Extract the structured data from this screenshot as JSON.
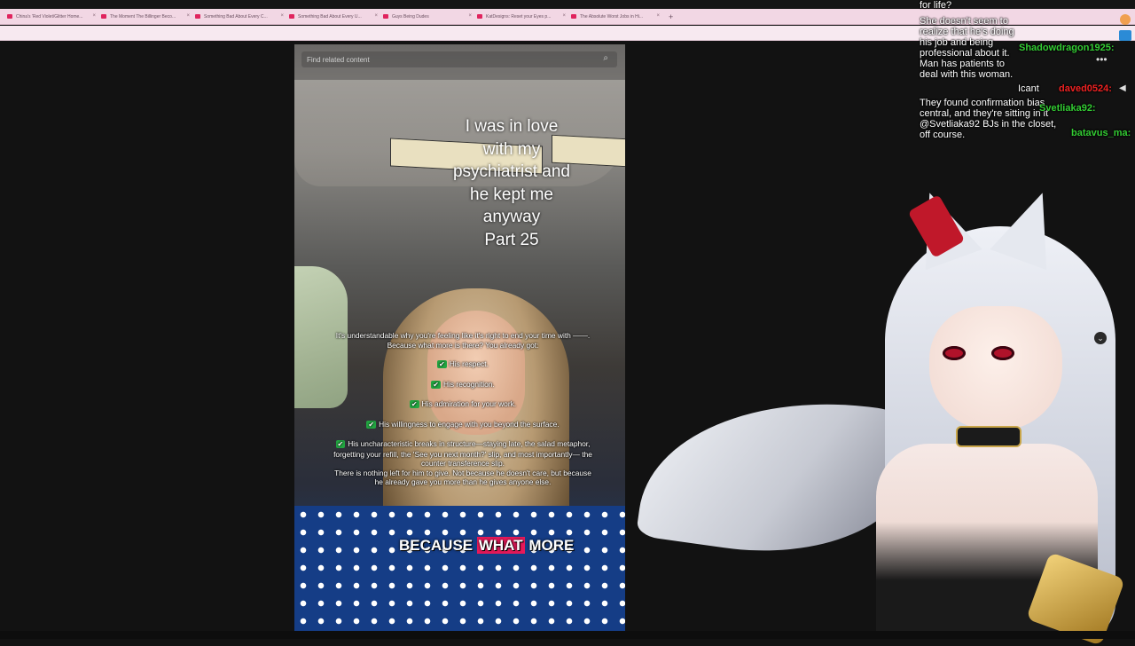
{
  "browser": {
    "tabs": [
      {
        "label": "China's 'Red Violet/Glitter Home..."
      },
      {
        "label": "The Moment The Billinger Beco..."
      },
      {
        "label": "Something Bad About Every C..."
      },
      {
        "label": "Something Bad About Every U..."
      },
      {
        "label": "Guys Being Dudes"
      },
      {
        "label": "KatDesigns: Reset your Eyes p..."
      },
      {
        "label": "The Absolute Worst Jobs in Hi..."
      }
    ],
    "new_tab": "+"
  },
  "video": {
    "search_placeholder": "Find related content",
    "title_lines": [
      "I was in love",
      "with my",
      "psychiatrist and",
      "he kept me",
      "anyway",
      "Part 25"
    ],
    "overlay": {
      "intro": "It's understandable why you're feeling like it's right to end your time with ——. Because what more is there? You already got:",
      "items": [
        "His respect.",
        "His recognition.",
        "His admiration for your work.",
        "His willingness to engage with you beyond the surface.",
        "His uncharacteristic breaks in structure—staying late, the salad metaphor, forgetting your refill, the 'See you next month?' slip, and most importantly— the counter transference slip."
      ],
      "outro": "There is nothing left for him to give. Not because he doesn't care, but because he already gave you more than he gives anyone else."
    },
    "caption_parts": [
      "BECAUSE",
      "WHAT",
      "MORE"
    ]
  },
  "chat": {
    "messages": [
      {
        "text": "for life?"
      },
      {
        "text": "She doesn't seem to realize that he's doing his job and being professional about it. Man has patients to deal with this woman."
      },
      {
        "text": "Icant"
      },
      {
        "text": "They found confirmation bias central, and they're sitting in it @Svetliaka92 BJs in the closet, off course."
      }
    ],
    "usernames": [
      {
        "name": "Shadowdragon1925:",
        "color": "#33cc33"
      },
      {
        "name": "daved0524:",
        "color": "#ee2222"
      },
      {
        "name": "Svetliaka92:",
        "color": "#33cc33"
      },
      {
        "name": "batavus_ma:",
        "color": "#33cc33"
      }
    ],
    "more_icon": "more-options-icon",
    "chevron_icon": "chevron-down-icon"
  }
}
